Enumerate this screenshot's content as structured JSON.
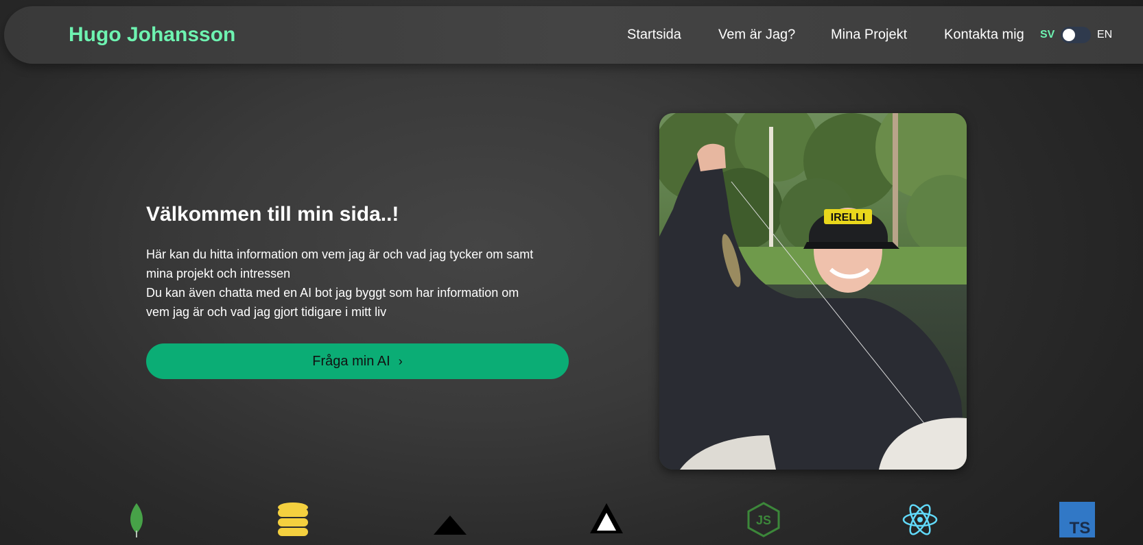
{
  "header": {
    "brand": "Hugo Johansson",
    "nav": [
      {
        "label": "Startsida"
      },
      {
        "label": "Vem är Jag?"
      },
      {
        "label": "Mina Projekt"
      },
      {
        "label": "Kontakta mig"
      }
    ],
    "language": {
      "left": "SV",
      "right": "EN",
      "active": "SV"
    }
  },
  "hero": {
    "title": "Välkommen till min sida..!",
    "lines": [
      "Här kan du hitta information om vem jag är och vad jag tycker om samt",
      "mina projekt och intressen",
      "Du kan även chatta med en AI bot jag byggt som har information om",
      "vem jag är och vad jag gjort tidigare i mitt liv"
    ],
    "cta_label": "Fråga min AI",
    "cta_chevron": "›",
    "photo_cap_text": "IRELLI"
  },
  "tech_icons": [
    {
      "icon": "mongodb-leaf-icon"
    },
    {
      "icon": "database-stack-icon"
    },
    {
      "icon": "vercel-triangle-icon"
    },
    {
      "icon": "outlined-triangle-icon"
    },
    {
      "icon": "nodejs-icon",
      "label": "JS"
    },
    {
      "icon": "react-atom-icon"
    },
    {
      "icon": "typescript-icon",
      "label": "TS"
    }
  ],
  "colors": {
    "accent": "#6ef3b1",
    "cta": "#0bad75",
    "toggle_track": "#2f3a4d",
    "mongodb": "#47a248",
    "database": "#f4d03f",
    "nodejs": "#3c873a",
    "react": "#61dafb",
    "typescript": "#3178c6"
  }
}
